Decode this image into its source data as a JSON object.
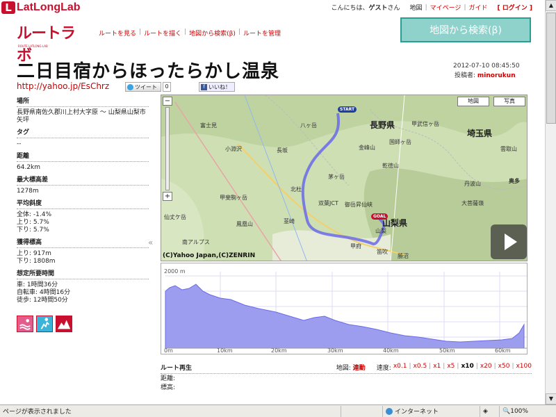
{
  "header": {
    "logo_mark": "L",
    "logo_text": "LatLongLab",
    "greeting_prefix": "こんにちは、",
    "greeting_user": "ゲスト",
    "greeting_suffix": "さん",
    "nav": [
      "地図",
      "マイページ",
      "ガイド"
    ],
    "login": "[ ログイン ]"
  },
  "brand": {
    "name": "ルートラボ",
    "tagline": "ROUTE LATLONG LAB"
  },
  "site_nav": [
    "ルートを見る",
    "ルートを描く",
    "地図から検索(β)",
    "ルートを管理"
  ],
  "map_search_button": "地図から検索(β)",
  "route": {
    "title": "二日目宿からほったらかし温泉",
    "short_url": "http://yahoo.jp/EsChrz",
    "tweet_label": "ツイート",
    "tweet_count": "0",
    "like_label": "いいね！",
    "datetime": "2012-07-10 08:45:50",
    "poster_label": "投稿者: ",
    "poster_name": "minorukun"
  },
  "info": {
    "place_label": "場所",
    "place": "長野県南佐久郡川上村大字原 〜 山梨県山梨市矢坪",
    "tag_label": "タグ",
    "tag": "--",
    "distance_label": "距離",
    "distance": "64.2km",
    "max_elev_diff_label": "最大標高差",
    "max_elev_diff": "1278m",
    "avg_slope_label": "平均斜度",
    "slope_all": "全体: -1.4%",
    "slope_up": "上り: 5.7%",
    "slope_down": "下り: 5.7%",
    "gain_label": "獲得標高",
    "gain_up": "上り: 917m",
    "gain_down": "下り: 1808m",
    "time_label": "想定所要時間",
    "time_car": "車: 1時間36分",
    "time_bike": "自転車: 4時間16分",
    "time_walk": "徒歩: 12時間50分"
  },
  "map": {
    "map_btn": "地図",
    "photo_btn": "写真",
    "copyright": "(C)Yahoo Japan,(C)ZENRIN",
    "start": "START",
    "goal": "GOAL",
    "prefectures": [
      "長野県",
      "埼玉県",
      "山梨県"
    ],
    "places": [
      "富士見",
      "小淵沢",
      "長坂",
      "北杜",
      "韮崎",
      "甲斐駒ヶ岳",
      "仙丈ケ岳",
      "鳳凰山",
      "双葉JCT",
      "甲府",
      "山梨",
      "勝沼",
      "八ヶ岳",
      "金峰山",
      "国師ヶ岳",
      "甲武信ヶ岳",
      "乾徳山",
      "雲取山",
      "丹波山",
      "大菩薩嶺",
      "奥多",
      "御岳昇仙峡",
      "笛吹",
      "茅ヶ岳",
      "南アルプス"
    ]
  },
  "profile": {
    "y_top_label": "2000 m",
    "x_labels": [
      "0m",
      "10km",
      "20km",
      "30km",
      "40km",
      "50km",
      "60km"
    ]
  },
  "playback": {
    "label": "ルート再生",
    "map_label": "地図: ",
    "map_value": "連動",
    "speed_label": "速度: ",
    "speeds": [
      "x0.1",
      "x0.5",
      "x1",
      "x5",
      "x10",
      "x20",
      "x50",
      "x100"
    ],
    "selected_speed": "x10",
    "distance_label": "距離:",
    "elevation_label": "標高:"
  },
  "statusbar": {
    "message": "ページが表示されました",
    "zone": "インターネット",
    "zoom": "100%"
  },
  "colors": {
    "brand_red": "#c8102e",
    "route_blue": "#6a6ae8",
    "teal": "#8fd1cb"
  }
}
